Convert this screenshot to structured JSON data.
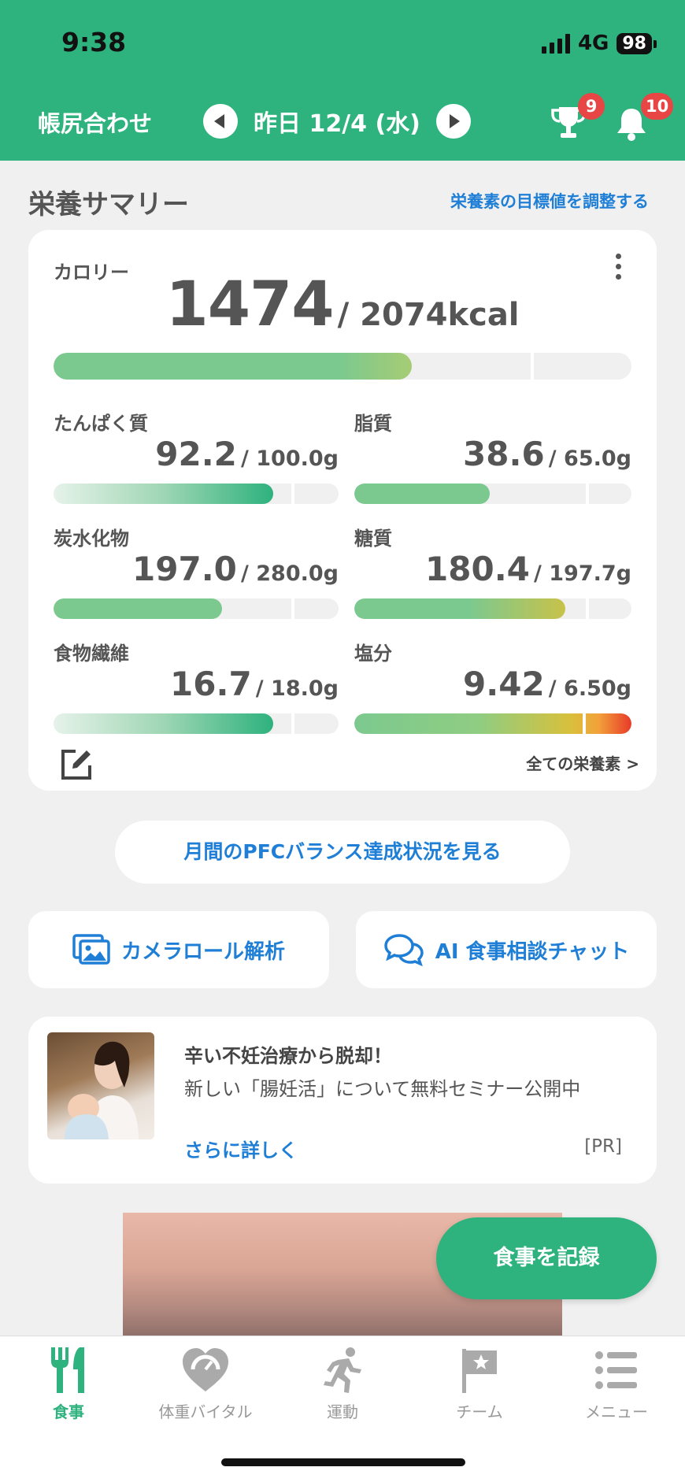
{
  "status": {
    "time": "9:38",
    "network": "4G",
    "battery": "98"
  },
  "header": {
    "title": "帳尻合わせ",
    "date": "昨日 12/4 (水)",
    "trophy_badge": "9",
    "bell_badge": "10",
    "accent": "#2eb27e"
  },
  "summary": {
    "title": "栄養サマリー",
    "adjust_link": "栄養素の目標値を調整する",
    "calorie": {
      "label": "カロリー",
      "value": "1474",
      "target": "/ 2074kcal",
      "progress": 0.62
    },
    "nutrients": [
      {
        "label": "たんぱく質",
        "value": "92.2",
        "target": "/ 100.0g",
        "progress": 0.77
      },
      {
        "label": "脂質",
        "value": "38.6",
        "target": "/ 65.0g",
        "progress": 0.49
      },
      {
        "label": "炭水化物",
        "value": "197.0",
        "target": "/ 280.0g",
        "progress": 0.59
      },
      {
        "label": "糖質",
        "value": "180.4",
        "target": "/ 197.7g",
        "progress": 0.76
      },
      {
        "label": "食物繊維",
        "value": "16.7",
        "target": "/ 18.0g",
        "progress": 0.77
      },
      {
        "label": "塩分",
        "value": "9.42",
        "target": "/ 6.50g",
        "progress": 1.0
      }
    ],
    "all_nutrients": "全ての栄養素 >"
  },
  "pfc_button": "月間のPFCバランス達成状況を見る",
  "actions": {
    "camera": "カメラロール解析",
    "ai_chat": "AI 食事相談チャット"
  },
  "ad": {
    "title": "辛い不妊治療から脱却！",
    "subtitle": "新しい「腸妊活」について無料セミナー公開中",
    "more": "さらに詳しく",
    "pr": "[PR]"
  },
  "record_button": "食事を記録",
  "tabs": [
    {
      "label": "食事",
      "icon": "fork-knife-icon",
      "active": true
    },
    {
      "label": "体重バイタル",
      "icon": "heart-scale-icon"
    },
    {
      "label": "運動",
      "icon": "running-icon"
    },
    {
      "label": "チーム",
      "icon": "flag-icon"
    },
    {
      "label": "メニュー",
      "icon": "menu-list-icon"
    }
  ]
}
